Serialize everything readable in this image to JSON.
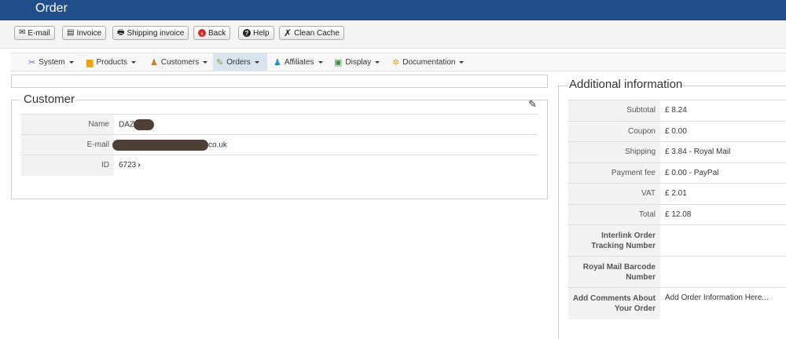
{
  "window": {
    "title": "Order"
  },
  "toolbar": {
    "email": "E-mail",
    "invoice": "Invoice",
    "shipping_invoice": "Shipping invoice",
    "back": "Back",
    "help": "Help",
    "clean_cache": "Clean Cache"
  },
  "menu": {
    "system": "System",
    "products": "Products",
    "customers": "Customers",
    "orders": "Orders",
    "affiliates": "Affiliates",
    "display": "Display",
    "documentation": "Documentation"
  },
  "customer": {
    "legend": "Customer",
    "name_label": "Name",
    "name_value": "DAZ",
    "email_label": "E-mail",
    "email_value": "co.uk",
    "id_label": "ID",
    "id_value": "6723"
  },
  "additional": {
    "legend": "Additional information",
    "rows": [
      {
        "label": "Subtotal",
        "value": "£ 8.24"
      },
      {
        "label": "Coupon",
        "value": "£ 0.00"
      },
      {
        "label": "Shipping",
        "value": "£ 3.84 - Royal Mail"
      },
      {
        "label": "Payment fee",
        "value": "£ 0.00 - PayPal"
      },
      {
        "label": "VAT",
        "value": "£ 2.01"
      },
      {
        "label": "Total",
        "value": "£ 12.08"
      },
      {
        "label": "Interlink Order Tracking Number",
        "value": ""
      },
      {
        "label": "Royal Mail Barcode Number",
        "value": ""
      },
      {
        "label": "Add Comments About Your Order",
        "value": "Add Order Information Here..."
      }
    ]
  }
}
